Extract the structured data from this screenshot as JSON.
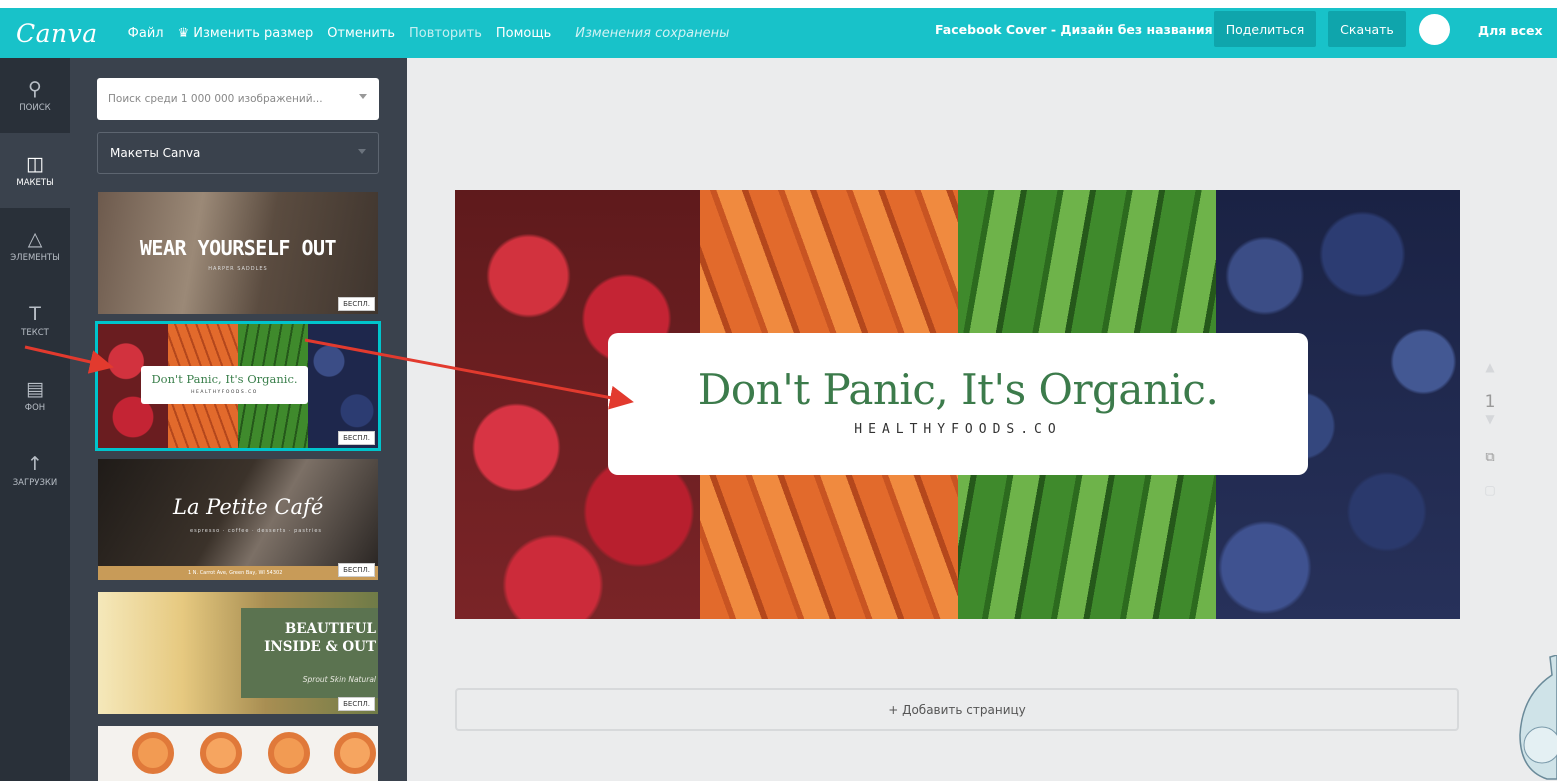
{
  "topbar": {
    "logo": "Canva",
    "menu": [
      "Файл",
      "Изменить размер",
      "Отменить",
      "Повторить",
      "Помощь"
    ],
    "crown_icon": "♛",
    "saved_status": "Изменения сохранены",
    "doc_title": "Facebook Cover - Дизайн без названия",
    "share_label": "Поделиться",
    "download_label": "Скачать",
    "visibility_label": "Для всех",
    "accent_color": "#18c2c9"
  },
  "sidenav": {
    "items": [
      {
        "label": "ПОИСК",
        "icon": "search-icon"
      },
      {
        "label": "МАКЕТЫ",
        "icon": "layouts-icon"
      },
      {
        "label": "ЭЛЕМЕНТЫ",
        "icon": "elements-icon"
      },
      {
        "label": "ТЕКСТ",
        "icon": "text-icon"
      },
      {
        "label": "ФОН",
        "icon": "background-icon"
      },
      {
        "label": "ЗАГРУЗКИ",
        "icon": "upload-icon"
      }
    ],
    "active_index": 1
  },
  "panel": {
    "search_placeholder": "Поиск среди 1 000 000 изображений...",
    "template_filter": "Макеты Canva",
    "free_badge": "БЕСПЛ.",
    "templates": [
      {
        "title": "WEAR YOURSELF OUT",
        "subtitle": "HARPER SADDLES",
        "free": true
      },
      {
        "title": "Don't Panic, It's Organic.",
        "subtitle": "HEALTHYFOODS.CO",
        "free": true,
        "selected": true
      },
      {
        "title": "La Petite Café",
        "subtitle": "espresso · coffee · desserts · pastries",
        "footer": "1 N. Carrot Ave, Green Bay, WI 54302",
        "free": true
      },
      {
        "title": "BEAUTIFUL INSIDE & OUT",
        "subtitle": "Sprout Skin Natural",
        "free": true
      }
    ]
  },
  "canvas": {
    "headline": "Don't Panic, It's Organic.",
    "domain": "HEALTHYFOODS.CO",
    "page_number": "1"
  },
  "add_page_label": "+ Добавить страницу"
}
